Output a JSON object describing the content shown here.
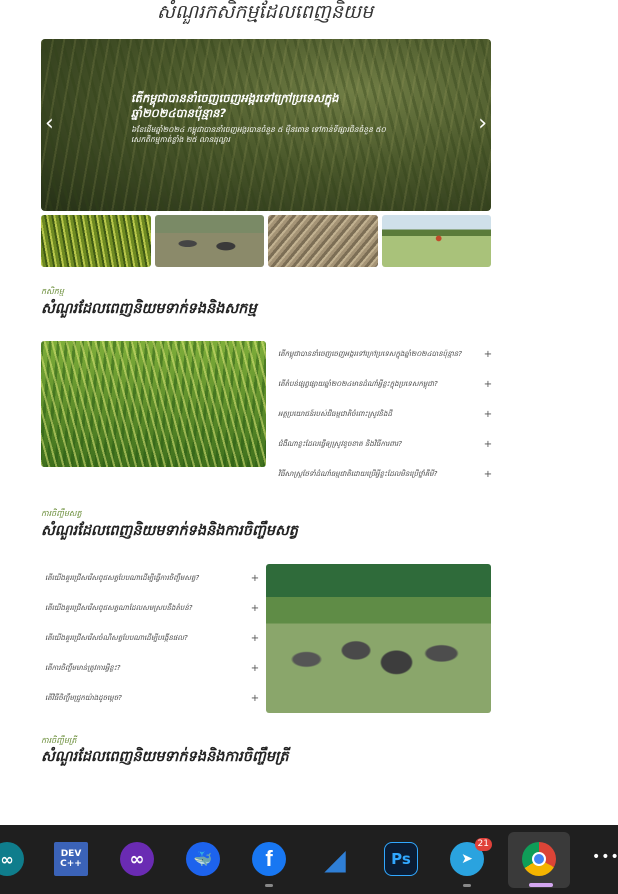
{
  "page_title": "សំណួរកសិកម្មដែលពេញនិយម",
  "hero": {
    "title": "តើកម្ពុជាបាននាំចេញចេញអង្ករទៅក្រៅប្រទេសក្នុងឆ្នាំ២០២៤បានប៉ុន្មាន?",
    "subtitle": "៦ខែដើមឆ្នាំ២០២៤ កម្ពុជាបាននាំចេញអង្ករបានចំនួន ៥ ម៉ឺនតោន ទៅកាន់ទីផ្សារចិនចំនួន ៥០ សេកតិកម្មកាត់ខ្លាំង ២៥ លានដុល្លារ",
    "prev_icon": "‹",
    "next_icon": "›"
  },
  "thumbnails": [
    {
      "icon": "rice-field-image"
    },
    {
      "icon": "buffalo-image"
    },
    {
      "icon": "straw-image"
    },
    {
      "icon": "farmer-spraying-image"
    }
  ],
  "sections": [
    {
      "kicker": "កសិកម្ម",
      "title": "សំណួរដែលពេញនិយមទាក់ទងនិងសកម្ម",
      "questions": [
        "តើកម្ពុជាបាននាំចេញចេញអង្ករទៅក្រៅប្រទេសក្នុងឆ្នាំ២០២៤បានប៉ុន្មាន?",
        "តើតំបន់ផ្សព្វផ្សាយឆ្នាំ២០២៤មានដំណាំអ្វីខ្លះក្នុងប្រទេសកម្ពុជា?",
        "អត្ថប្រយោជន៍របស់ជីធម្មជាតិចំពោះស្រូវនិងដី",
        "ជំងឺណាខ្លះដែលធ្វើឲ្យស្រូវខូចខាត និងវិធីការពារ?",
        "វិធីសាស្ត្រថែទាំដំណាំធម្មជាតិដោយប្រើអ្វីខ្លះដែលមិនប្រើថ្នាំគីមី?"
      ],
      "plus": "+"
    },
    {
      "kicker": "ការចិញ្ចឹមសត្វ",
      "title": "សំណួរដែលពេញនិយមទាក់ទងនិងការចិញ្ចឹមសត្វ",
      "questions": [
        "តើយើងគួរជ្រើសរើសពូជសត្វបែបណាដើម្បីធ្វើការចិញ្ចឹមសត្វ?",
        "តើយើងគួរជ្រើសរើសពូជសត្វណាដែលសមស្របនឹងតំបន់?",
        "តើយើងគួរជ្រើសរើសចំណីសត្វបែបណាដើម្បីបង្កើនផល?",
        "តើការចិញ្ចឹមមាន់ត្រូវការអ្វីខ្លះ?",
        "តើវិធីចិញ្ចឹមជ្រូកយ៉ាងដូចម្តេច?"
      ],
      "plus": "+"
    },
    {
      "kicker": "ការចិញ្ចឹមត្រី",
      "title": "សំណួរដែលពេញនិយមទាក់ទងនិងការចិញ្ចឹមត្រី"
    }
  ],
  "taskbar": {
    "apps": [
      {
        "name": "arduino",
        "label": "∞",
        "color": "#0f7d8c"
      },
      {
        "name": "dev-cpp",
        "label": "DEV C++",
        "color": "#3b63b8"
      },
      {
        "name": "infinity-app",
        "label": "∞",
        "color": "#6a2bb3"
      },
      {
        "name": "docker",
        "label": "🐳",
        "color": "#1d63ed"
      },
      {
        "name": "facebook",
        "label": "f",
        "color": "#1877f2"
      },
      {
        "name": "wireshark",
        "label": "◢",
        "color": "#1a5bb5"
      },
      {
        "name": "photoshop",
        "label": "Ps",
        "color": "#0b1c33"
      },
      {
        "name": "telegram",
        "label": "➤",
        "color": "#2aa3df",
        "badge": "21"
      },
      {
        "name": "chrome",
        "label": "●",
        "color": "#2b2b2b"
      }
    ],
    "more_icon": "•••"
  }
}
